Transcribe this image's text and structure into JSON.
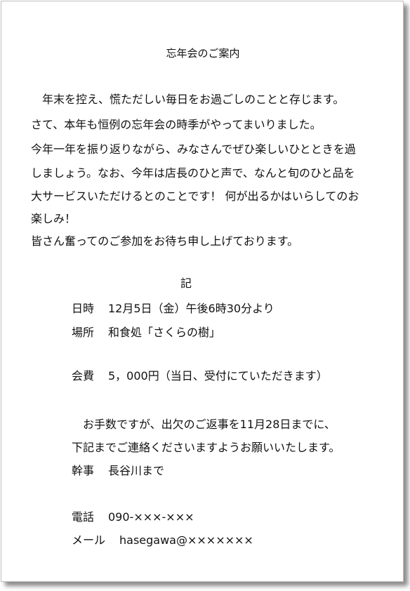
{
  "title": "忘年会のご案内",
  "body_lines": [
    "　年末を控え、慌ただしい毎日をお過ごしのことと存じます。",
    "さて、本年も恒例の忘年会の時季がやってまいりました。",
    "今年一年を振り返りながら、みなさんでぜひ楽しいひとときを過",
    "しましょう。なお、今年は店長のひと声で、なんと旬のひと品を",
    "大サービスいただけるとのことです！ 何が出るかはいらしてのお",
    "楽しみ！",
    "皆さん奮ってのご参加をお待ち申し上げております。"
  ],
  "ki": "記",
  "datetime": {
    "label": "日時",
    "value": "12月5日（金）午後6時30分より"
  },
  "place": {
    "label": "場所",
    "value": "和食処「さくらの樹」"
  },
  "fee": {
    "label": "会費",
    "value": "5，000円（当日、受付にていただきます）"
  },
  "request_line1": "　お手数ですが、出欠のご返事を11月28日までに、",
  "request_line2": "下記までご連絡くださいますようお願いいたします。",
  "organizer": {
    "label": "幹事",
    "value": "長谷川まで"
  },
  "phone": {
    "label": "電話",
    "value": "090-×××-×××"
  },
  "mail": {
    "label": "メール",
    "value": "hasegawa@×××××××"
  }
}
